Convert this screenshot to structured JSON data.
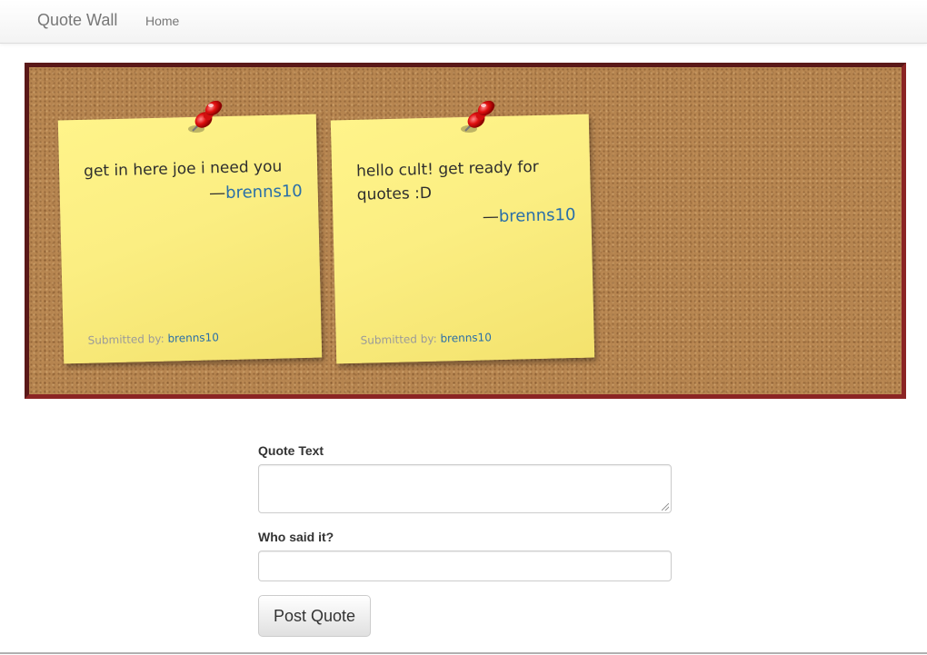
{
  "navbar": {
    "brand": "Quote Wall",
    "home_label": "Home"
  },
  "board": {
    "notes": [
      {
        "text": "get in here joe i need you",
        "dash": "—",
        "author": "brenns10",
        "submitted_label": "Submitted by: ",
        "submitted_by": "brenns10"
      },
      {
        "text": "hello cult! get ready for quotes :D",
        "dash": "—",
        "author": "brenns10",
        "submitted_label": "Submitted by: ",
        "submitted_by": "brenns10"
      }
    ],
    "pin_icon": "pushpin-icon",
    "colors": {
      "frame": "#8b2424",
      "cork": "#b5844f",
      "note": "#fbee82",
      "link": "#2a6fa8"
    }
  },
  "form": {
    "quote_label": "Quote Text",
    "quote_value": "",
    "who_label": "Who said it?",
    "who_value": "",
    "submit_label": "Post Quote"
  }
}
